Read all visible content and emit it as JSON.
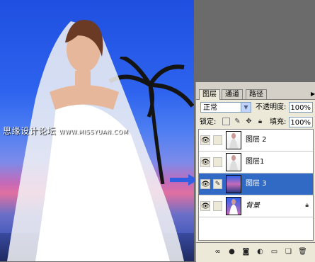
{
  "watermark": {
    "text": "思缘设计论坛 ",
    "url": "WWW.MISSYUAN.COM"
  },
  "panel": {
    "tabs": [
      {
        "label": "图层"
      },
      {
        "label": "通道"
      },
      {
        "label": "路径"
      }
    ],
    "blend_mode": "正常",
    "opacity_label": "不透明度:",
    "opacity_value": "100%",
    "lock_label": "锁定:",
    "fill_label": "填充:",
    "fill_value": "100%",
    "layers": [
      {
        "name": "图层 2",
        "selected": false,
        "locked": false
      },
      {
        "name": "图层1",
        "selected": false,
        "locked": false
      },
      {
        "name": "图层 3",
        "selected": true,
        "locked": false
      },
      {
        "name": "背景",
        "selected": false,
        "locked": true
      }
    ]
  },
  "colors": {
    "selection": "#316ac5",
    "panel_bg": "#ece9d8",
    "arrow": "#2f5fe0"
  },
  "icons": [
    "eye-icon",
    "brush-icon",
    "lock-icon",
    "link-icon",
    "fx-icon",
    "mask-icon",
    "adjustment-icon",
    "folder-icon",
    "new-layer-icon",
    "trash-icon",
    "panel-menu-icon",
    "dropdown-arrow-icon"
  ]
}
